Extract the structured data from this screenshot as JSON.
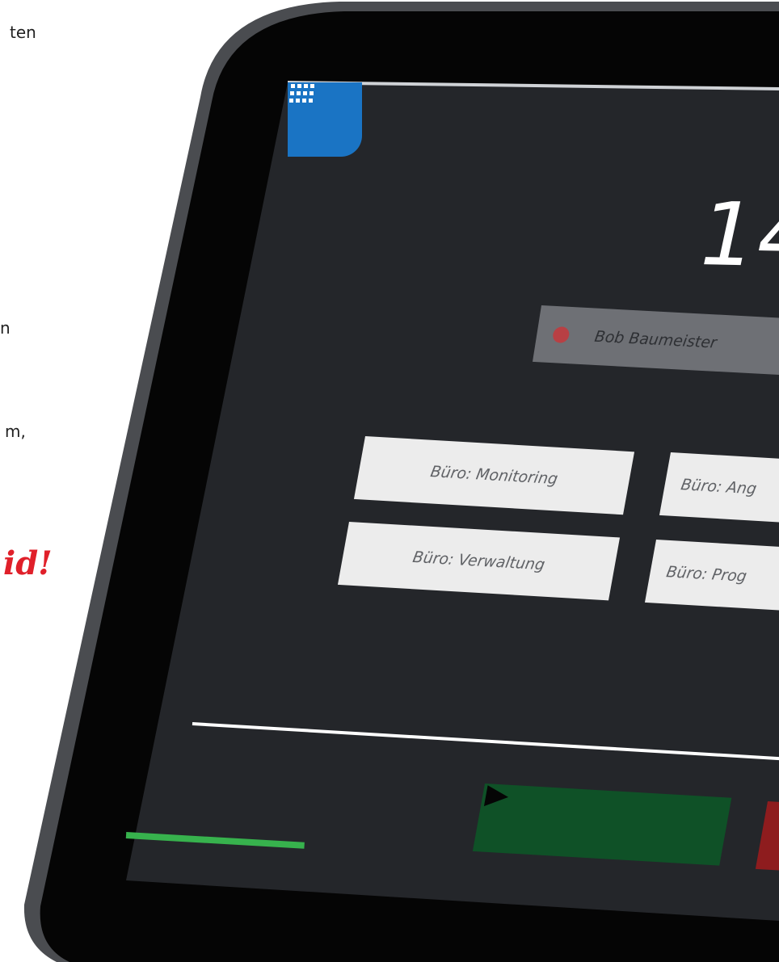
{
  "article_fragments": {
    "line_1": "ten",
    "line_2": "n",
    "line_3": "m,",
    "highlight": "id!"
  },
  "tablet": {
    "clock_display": "14",
    "user": {
      "name": "Bob Baumeister",
      "status_color": "#b84044"
    },
    "office_buttons": [
      {
        "label": "Büro: Monitoring"
      },
      {
        "label": "Büro: Ang"
      },
      {
        "label": "Büro: Verwaltung"
      },
      {
        "label": "Büro: Prog"
      }
    ],
    "controls": {
      "play_icon": "play-icon",
      "play_color": "#0f5127",
      "stop_color": "#8e1c1e"
    },
    "progress": {
      "fraction": 0.27,
      "color": "#37b24d"
    },
    "accent_color": "#1a74c4",
    "apps_icon": "apps-grid-icon"
  }
}
